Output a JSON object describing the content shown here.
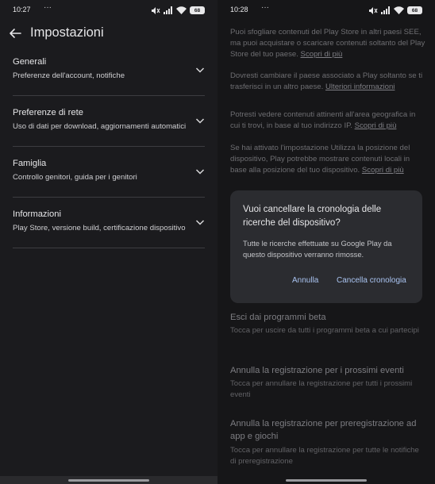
{
  "left": {
    "status": {
      "time": "10:27",
      "dots": "···",
      "battery": "68"
    },
    "header": {
      "title": "Impostazioni"
    },
    "menu": [
      {
        "title": "Generali",
        "subtitle": "Preferenze dell'account, notifiche"
      },
      {
        "title": "Preferenze di rete",
        "subtitle": "Uso di dati per download, aggiornamenti automatici"
      },
      {
        "title": "Famiglia",
        "subtitle": "Controllo genitori, guida per i genitori"
      },
      {
        "title": "Informazioni",
        "subtitle": "Play Store, versione build, certificazione dispositivo"
      }
    ]
  },
  "right": {
    "status": {
      "time": "10:28",
      "dots": "···",
      "battery": "68"
    },
    "paragraphs": [
      {
        "text": "Puoi sfogliare contenuti del Play Store in altri paesi SEE, ma puoi acquistare o scaricare contenuti soltanto del Play Store del tuo paese.",
        "link": "Scopri di più"
      },
      {
        "text": "Dovresti cambiare il paese associato a Play soltanto se ti trasferisci in un altro paese.",
        "link": "Ulteriori informazioni"
      },
      {
        "text": "Potresti vedere contenuti attinenti all'area geografica in cui ti trovi, in base al tuo indirizzo IP.",
        "link": "Scopri di più"
      },
      {
        "text": "Se hai attivato l'impostazione Utilizza la posizione del dispositivo, Play potrebbe mostrare contenuti locali in base alla posizione del tuo dispositivo.",
        "link": "Scopri di più"
      }
    ],
    "dialog": {
      "title": "Vuoi cancellare la cronologia delle ricerche del dispositivo?",
      "body": "Tutte le ricerche effettuate su Google Play da questo dispositivo verranno rimosse.",
      "cancel_label": "Annulla",
      "confirm_label": "Cancella cronologia"
    },
    "sections": [
      {
        "title": "Esci dai programmi beta",
        "subtitle": "Tocca per uscire da tutti i programmi beta a cui partecipi"
      },
      {
        "title": "Annulla la registrazione per i prossimi eventi",
        "subtitle": "Tocca per annullare la registrazione per tutti i prossimi eventi"
      },
      {
        "title": "Annulla la registrazione per preregistrazione ad app e giochi",
        "subtitle": "Tocca per annullare la registrazione per tutte le notifiche di preregistrazione"
      }
    ]
  },
  "colors": {
    "accent": "#a9c3f0",
    "background_dark": "#1b1b1e",
    "dialog_bg": "#2b2c30"
  }
}
